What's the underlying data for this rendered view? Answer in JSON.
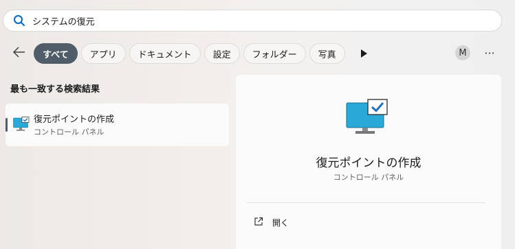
{
  "search": {
    "value": "システムの復元",
    "icon": "search-icon"
  },
  "filters": [
    {
      "label": "すべて",
      "active": true
    },
    {
      "label": "アプリ",
      "active": false
    },
    {
      "label": "ドキュメント",
      "active": false
    },
    {
      "label": "設定",
      "active": false
    },
    {
      "label": "フォルダー",
      "active": false
    },
    {
      "label": "写真",
      "active": false
    }
  ],
  "account": {
    "initial": "M"
  },
  "more_label": "···",
  "best_match": {
    "heading": "最も一致する検索結果",
    "item": {
      "title": "復元ポイントの作成",
      "subtitle": "コントロール パネル",
      "icon": "monitor-check-icon"
    }
  },
  "detail": {
    "title": "復元ポイントの作成",
    "subtitle": "コントロール パネル",
    "icon": "monitor-check-icon",
    "actions": [
      {
        "label": "開く",
        "icon": "open-external-icon"
      }
    ]
  },
  "colors": {
    "accent": "#4f5d68",
    "search_icon": "#0067c0",
    "monitor_screen": "#29a9d8"
  }
}
